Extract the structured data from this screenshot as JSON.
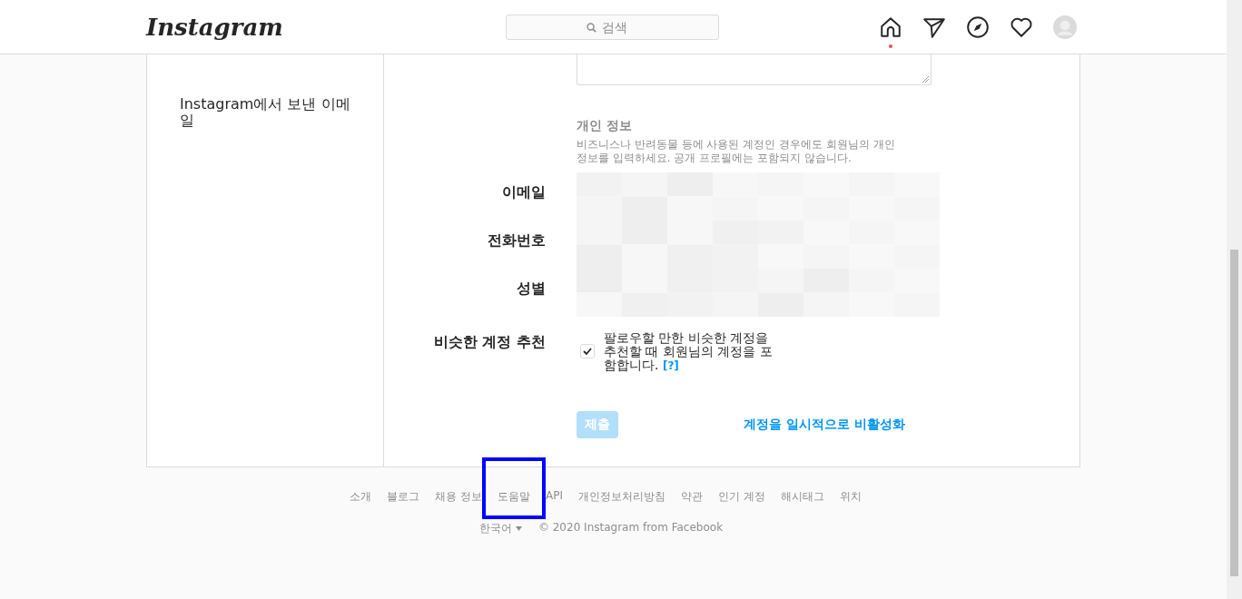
{
  "header": {
    "logo": "Instagram",
    "search": {
      "placeholder": "검색"
    },
    "nav": [
      {
        "kind": "home",
        "badge": true
      },
      {
        "kind": "send",
        "badge": false
      },
      {
        "kind": "explore",
        "badge": false
      },
      {
        "kind": "heart",
        "badge": false
      },
      {
        "kind": "avatar",
        "badge": false
      }
    ]
  },
  "sidebar": {
    "items": [
      {
        "label": "Instagram에서 보낸 이메일"
      }
    ]
  },
  "form": {
    "section_title": "개인 정보",
    "section_description": "비즈니스나 반려동물 등에 사용된 계정인 경우에도 회원님의 개인 정보를 입력하세요. 공개 프로필에는 포함되지 않습니다.",
    "fields": [
      {
        "label": "이메일"
      },
      {
        "label": "전화번호"
      },
      {
        "label": "성별"
      }
    ],
    "similar": {
      "label": "비슷한 계정 추천",
      "text": "팔로우할 만한 비슷한 계정을 추천할 때 회원님의 계정을 포함합니다.",
      "help": "[?]",
      "checked": true
    },
    "submit": {
      "label": "제출",
      "disabled": true
    },
    "deactivate": "계정을 일시적으로 비활성화"
  },
  "footer": {
    "links": [
      {
        "label": "소개",
        "highlighted": false
      },
      {
        "label": "블로그",
        "highlighted": false
      },
      {
        "label": "채용 정보",
        "highlighted": false
      },
      {
        "label": "도움말",
        "highlighted": true
      },
      {
        "label": "API",
        "highlighted": false
      },
      {
        "label": "개인정보처리방침",
        "highlighted": false
      },
      {
        "label": "약관",
        "highlighted": false
      },
      {
        "label": "인기 계정",
        "highlighted": false
      },
      {
        "label": "해시태그",
        "highlighted": false
      },
      {
        "label": "위치",
        "highlighted": false
      }
    ],
    "language": "한국어",
    "copyright": "© 2020 Instagram from Facebook"
  }
}
